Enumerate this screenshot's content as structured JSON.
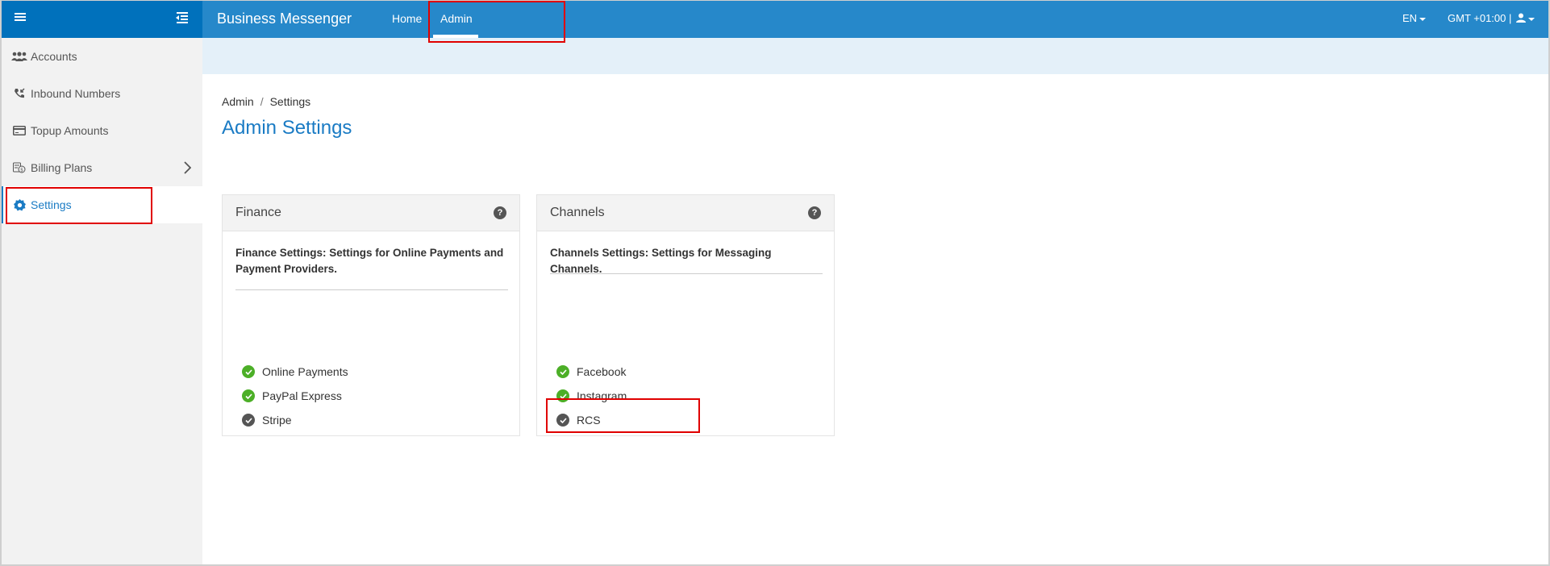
{
  "header": {
    "brand": "Business Messenger",
    "nav": [
      {
        "label": "Home",
        "active": false
      },
      {
        "label": "Admin",
        "active": true
      }
    ],
    "language": "EN",
    "timezone": "GMT +01:00 |"
  },
  "sidebar": {
    "items": [
      {
        "label": "Accounts",
        "icon": "users-icon",
        "active": false
      },
      {
        "label": "Inbound Numbers",
        "icon": "phone-incoming-icon",
        "active": false
      },
      {
        "label": "Topup Amounts",
        "icon": "credit-card-icon",
        "active": false
      },
      {
        "label": "Billing Plans",
        "icon": "billing-coins-icon",
        "active": false,
        "has_submenu": true
      },
      {
        "label": "Settings",
        "icon": "gear-icon",
        "active": true
      }
    ]
  },
  "breadcrumb": {
    "items": [
      "Admin",
      "Settings"
    ],
    "separator": "/"
  },
  "page": {
    "title": "Admin Settings"
  },
  "cards": [
    {
      "title": "Finance",
      "description": "Finance Settings: Settings for Online Payments and Payment Providers.",
      "items": [
        {
          "label": "Online Payments",
          "status": "enabled"
        },
        {
          "label": "PayPal Express",
          "status": "enabled"
        },
        {
          "label": "Stripe",
          "status": "disabled"
        }
      ]
    },
    {
      "title": "Channels",
      "description": "Channels Settings: Settings for Messaging Channels.",
      "items": [
        {
          "label": "Facebook",
          "status": "enabled"
        },
        {
          "label": "Instagram",
          "status": "enabled"
        },
        {
          "label": "RCS",
          "status": "disabled"
        }
      ]
    }
  ],
  "colors": {
    "sidebar_header": "#0071bc",
    "topbar": "#2688ca",
    "accent": "#1a7bc4",
    "enabled": "#4caf27",
    "disabled": "#555555",
    "annotation": "#e00000"
  }
}
